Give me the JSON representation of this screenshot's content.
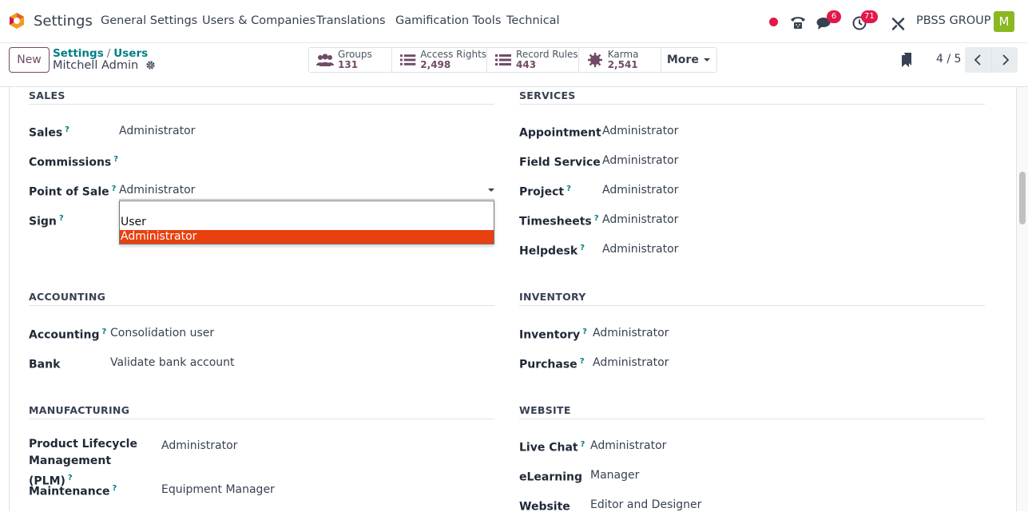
{
  "navbar": {
    "app_name": "Settings",
    "menu": [
      "General Settings",
      "Users & Companies",
      "Translations",
      "Gamification Tools",
      "Technical"
    ],
    "messages_badge": "6",
    "activities_badge": "71",
    "company": "PBSS GROUP",
    "avatar_letter": "M",
    "colors": {
      "accent": "#714b67",
      "link": "#017e84",
      "badge": "#e3174a",
      "avatar": "#8ab821",
      "recording_dot": "#e3174a"
    }
  },
  "control": {
    "new_label": "New",
    "breadcrumb": [
      "Settings",
      "Users"
    ],
    "record_title": "Mitchell Admin",
    "stats": [
      {
        "label": "Groups",
        "value": "131",
        "icon": "users-icon"
      },
      {
        "label": "Access Rights",
        "value": "2,498",
        "icon": "list-icon"
      },
      {
        "label": "Record Rules",
        "value": "443",
        "icon": "list-icon"
      },
      {
        "label": "Karma",
        "value": "2,541",
        "icon": "karma-icon"
      }
    ],
    "more_label": "More",
    "pager": "4 / 5"
  },
  "sections": {
    "sales": {
      "title": "SALES",
      "fields": [
        {
          "label": "Sales",
          "help": "?",
          "value": "Administrator"
        },
        {
          "label": "Commissions",
          "help": "?",
          "value": ""
        },
        {
          "label": "Point of Sale",
          "help": "?",
          "value": "Administrator"
        },
        {
          "label": "Sign",
          "help": "?",
          "value": ""
        }
      ]
    },
    "services": {
      "title": "SERVICES",
      "fields": [
        {
          "label": "Appointment",
          "help": "",
          "value": "Administrator"
        },
        {
          "label": "Field Service",
          "help": "",
          "value": "Administrator"
        },
        {
          "label": "Project",
          "help": "?",
          "value": "Administrator"
        },
        {
          "label": "Timesheets",
          "help": "?",
          "value": "Administrator"
        },
        {
          "label": "Helpdesk",
          "help": "?",
          "value": "Administrator"
        }
      ]
    },
    "accounting": {
      "title": "ACCOUNTING",
      "fields": [
        {
          "label": "Accounting",
          "help": "?",
          "value": "Consolidation user"
        },
        {
          "label": "Bank",
          "help": "",
          "value": "Validate bank account"
        }
      ]
    },
    "inventory": {
      "title": "INVENTORY",
      "fields": [
        {
          "label": "Inventory",
          "help": "?",
          "value": "Administrator"
        },
        {
          "label": "Purchase",
          "help": "?",
          "value": "Administrator"
        }
      ]
    },
    "manufacturing": {
      "title": "MANUFACTURING",
      "fields": [
        {
          "label": "Product Lifecycle Management (PLM)",
          "help": "?",
          "value": "Administrator"
        },
        {
          "label": "Maintenance",
          "help": "?",
          "value": "Equipment Manager"
        }
      ]
    },
    "website": {
      "title": "WEBSITE",
      "fields": [
        {
          "label": "Live Chat",
          "help": "?",
          "value": "Administrator"
        },
        {
          "label": "eLearning",
          "help": "",
          "value": "Manager"
        },
        {
          "label": "Website",
          "help": "",
          "value": "Editor and Designer"
        }
      ]
    }
  },
  "dropdown": {
    "options": [
      "",
      "User",
      "Administrator"
    ],
    "selected": "Administrator",
    "highlight_color": "#e8400e"
  }
}
